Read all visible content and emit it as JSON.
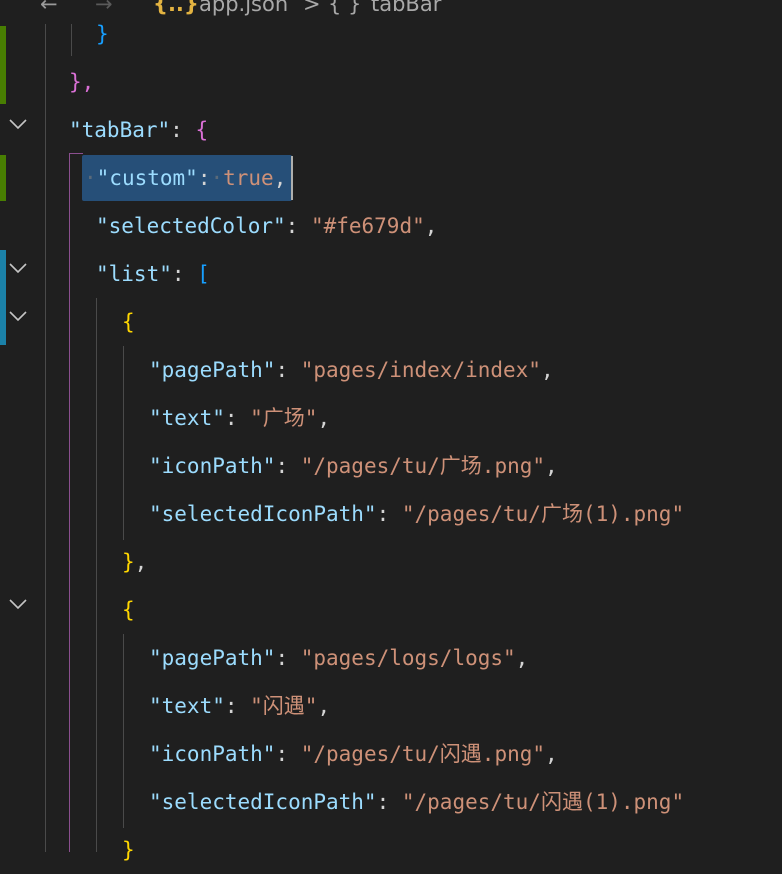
{
  "breadcrumb": {
    "back_icon": "←",
    "forward_icon": "→",
    "file_icon": "{..}",
    "file_name": "app.json",
    "separator": ">",
    "symbol_icon": "{ }",
    "symbol_name": "tabBar"
  },
  "code": {
    "l1_close": "}",
    "l2_close": "},",
    "tabbar_key": "\"tabBar\"",
    "custom_key": "\"custom\"",
    "custom_val": "true",
    "selected_color_key": "\"selectedColor\"",
    "selected_color_val": "\"#fe679d\"",
    "list_key": "\"list\"",
    "page_path_key": "\"pagePath\"",
    "text_key": "\"text\"",
    "icon_path_key": "\"iconPath\"",
    "selected_icon_path_key": "\"selectedIconPath\"",
    "item1": {
      "page_path": "\"pages/index/index\"",
      "text": "\"广场\"",
      "icon_path": "\"/pages/tu/广场.png\"",
      "selected_icon_path": "\"/pages/tu/广场(1).png\""
    },
    "item2": {
      "page_path": "\"pages/logs/logs\"",
      "text": "\"闪遇\"",
      "icon_path": "\"/pages/tu/闪遇.png\"",
      "selected_icon_path": "\"/pages/tu/闪遇(1).png\""
    }
  },
  "colors": {
    "background": "#1f1f1f",
    "key": "#9cdcfe",
    "string": "#ce9178",
    "bracket_gold": "#ffd700",
    "bracket_pink": "#da70d6",
    "bracket_blue": "#179fff",
    "selection": "#264f78",
    "gutter_added": "#487e02",
    "gutter_modified": "#1b81a8"
  }
}
